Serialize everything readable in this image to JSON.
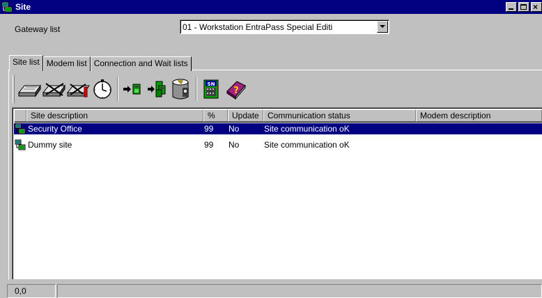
{
  "window": {
    "title": "Site"
  },
  "gateway": {
    "label": "Gateway list",
    "selected": "01 - Workstation EntraPass Special Editi"
  },
  "tabs": [
    {
      "label": "Site list",
      "active": true
    },
    {
      "label": "Modem list",
      "active": false
    },
    {
      "label": "Connection and Wait lists",
      "active": false
    }
  ],
  "toolbar": {
    "buttons": [
      "modem-icon",
      "modem-disabled-icon",
      "modem-reset-icon",
      "clock-icon",
      "send-to-controller-icon",
      "send-to-controllers-icon",
      "database-icon",
      "serial-number-icon",
      "help-book-icon"
    ]
  },
  "list": {
    "columns": [
      "Site description",
      "%",
      "Update",
      "Communication status",
      "Modem description"
    ],
    "rows": [
      {
        "description": "Security Office",
        "percent": "99",
        "update": "No",
        "status": "Site communication oK",
        "modem": "",
        "selected": true
      },
      {
        "description": "Dummy site",
        "percent": "99",
        "update": "No",
        "status": "Site communication oK",
        "modem": "",
        "selected": false
      }
    ]
  },
  "statusbar": {
    "position": "0,0",
    "message": ""
  },
  "colors": {
    "titlebar": "#000080",
    "selection": "#000080",
    "face": "#c0c0c0"
  }
}
